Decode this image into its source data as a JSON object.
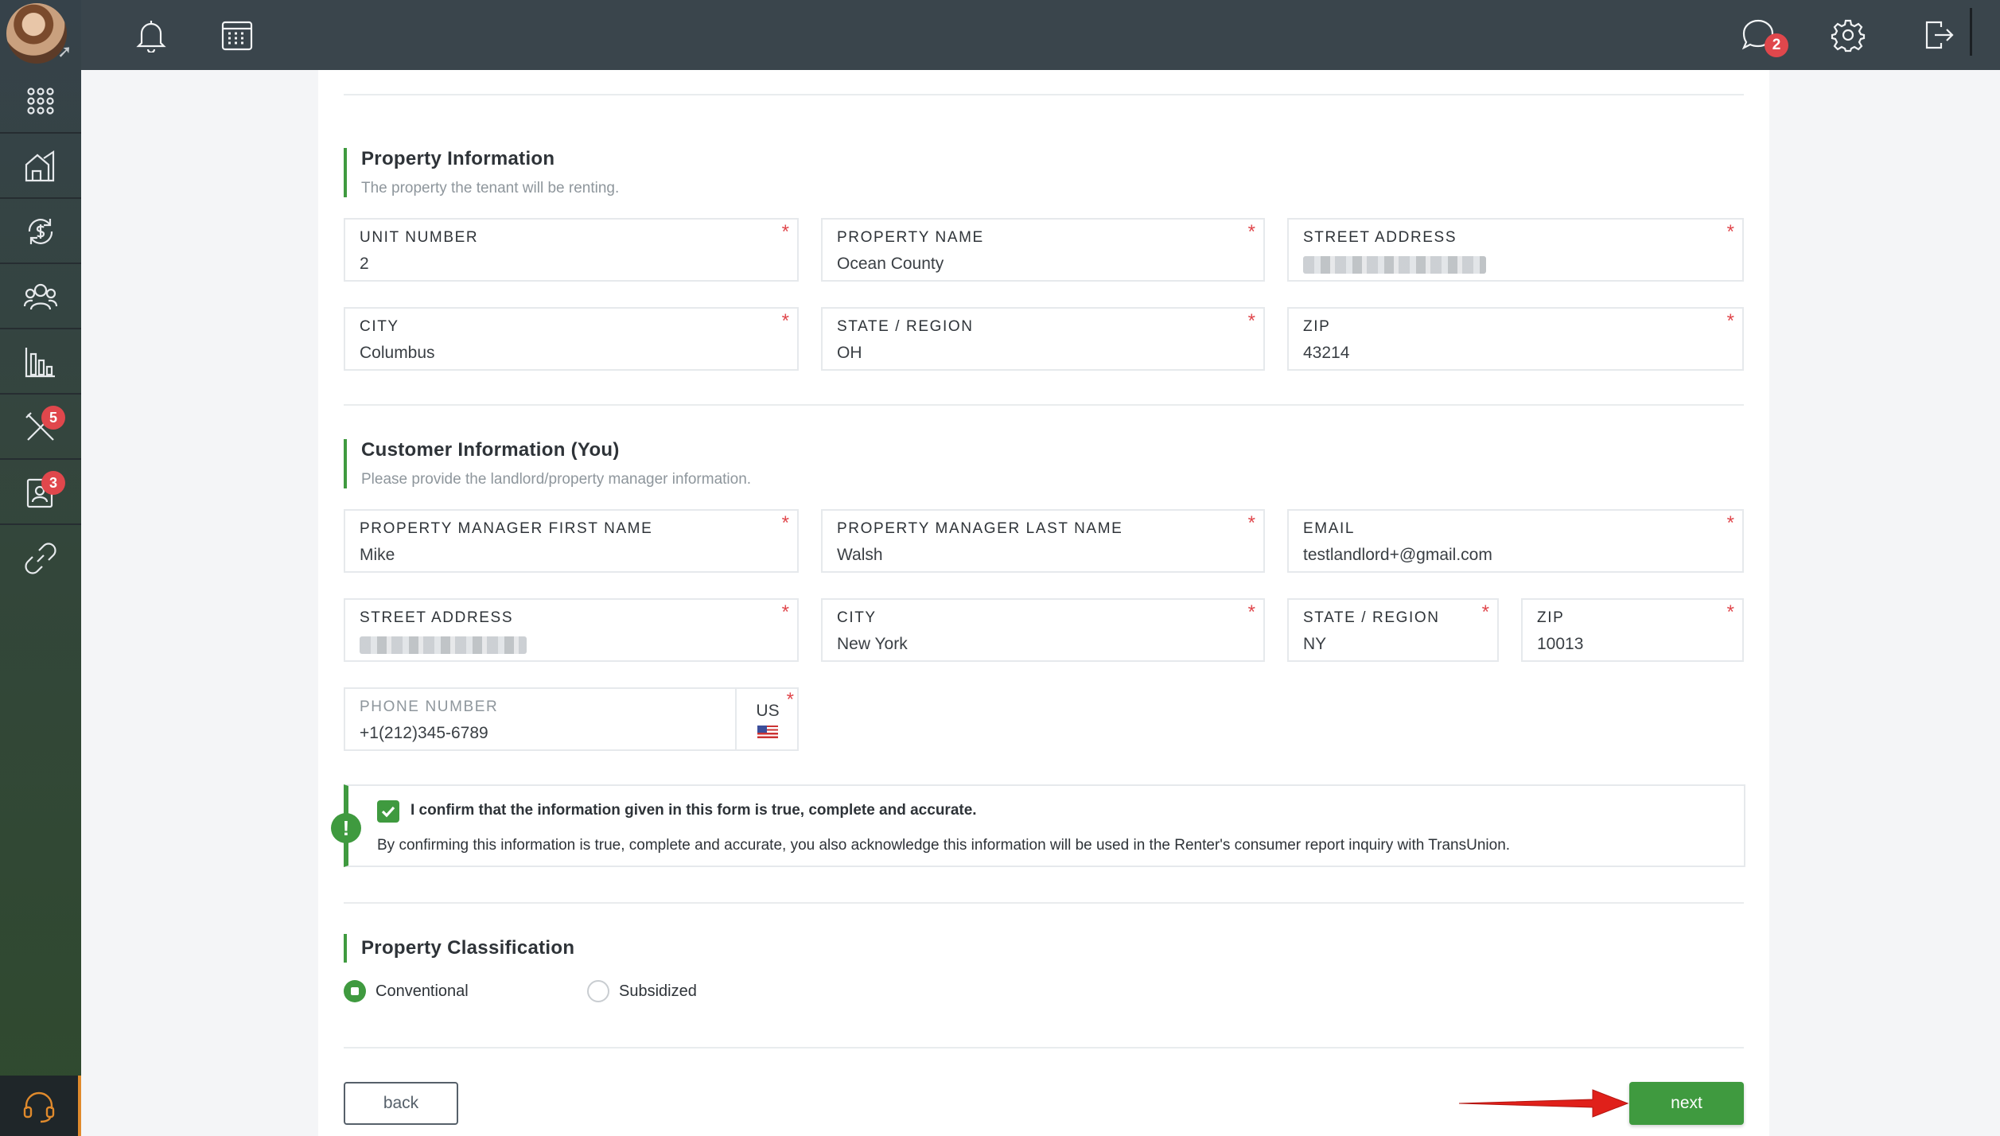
{
  "topbar": {
    "messages_badge": "2"
  },
  "sidebar": {
    "items": [
      {
        "name": "apps",
        "badge": ""
      },
      {
        "name": "properties",
        "badge": ""
      },
      {
        "name": "payments",
        "badge": ""
      },
      {
        "name": "people",
        "badge": ""
      },
      {
        "name": "reports",
        "badge": ""
      },
      {
        "name": "maintenance",
        "badge": "5"
      },
      {
        "name": "applications",
        "badge": "3"
      },
      {
        "name": "integrations",
        "badge": ""
      }
    ]
  },
  "property_info": {
    "title": "Property Information",
    "subtitle": "The property the tenant will be renting.",
    "unit_number": {
      "label": "UNIT NUMBER",
      "value": "2"
    },
    "property_name": {
      "label": "PROPERTY NAME",
      "value": "Ocean County"
    },
    "street_address": {
      "label": "STREET ADDRESS"
    },
    "city": {
      "label": "CITY",
      "value": "Columbus"
    },
    "state": {
      "label": "STATE / REGION",
      "value": "OH"
    },
    "zip": {
      "label": "ZIP",
      "value": "43214"
    }
  },
  "customer_info": {
    "title": "Customer Information (You)",
    "subtitle": "Please provide the landlord/property manager information.",
    "first_name": {
      "label": "PROPERTY MANAGER FIRST NAME",
      "value": "Mike"
    },
    "last_name": {
      "label": "PROPERTY MANAGER LAST NAME",
      "value": "Walsh"
    },
    "email": {
      "label": "EMAIL",
      "value": "testlandlord+@gmail.com"
    },
    "street_address": {
      "label": "STREET ADDRESS"
    },
    "city": {
      "label": "CITY",
      "value": "New York"
    },
    "state": {
      "label": "STATE / REGION",
      "value": "NY"
    },
    "zip": {
      "label": "ZIP",
      "value": "10013"
    },
    "phone": {
      "label": "PHONE NUMBER",
      "value": "+1(212)345-6789",
      "country": "US"
    }
  },
  "confirmation": {
    "title": "I confirm that the information given in this form is true, complete and accurate.",
    "body": "By confirming this information is true, complete and accurate, you also acknowledge this information will be used in the Renter's consumer report inquiry with TransUnion.",
    "checked": true
  },
  "classification": {
    "title": "Property Classification",
    "options": [
      "Conventional",
      "Subsidized"
    ],
    "selected": "Conventional"
  },
  "buttons": {
    "back": "back",
    "next": "next"
  },
  "colors": {
    "accent_green": "#3f9a3f",
    "required_red": "#e0474c",
    "topbar": "#3a454c",
    "support_orange": "#e08a2c"
  }
}
